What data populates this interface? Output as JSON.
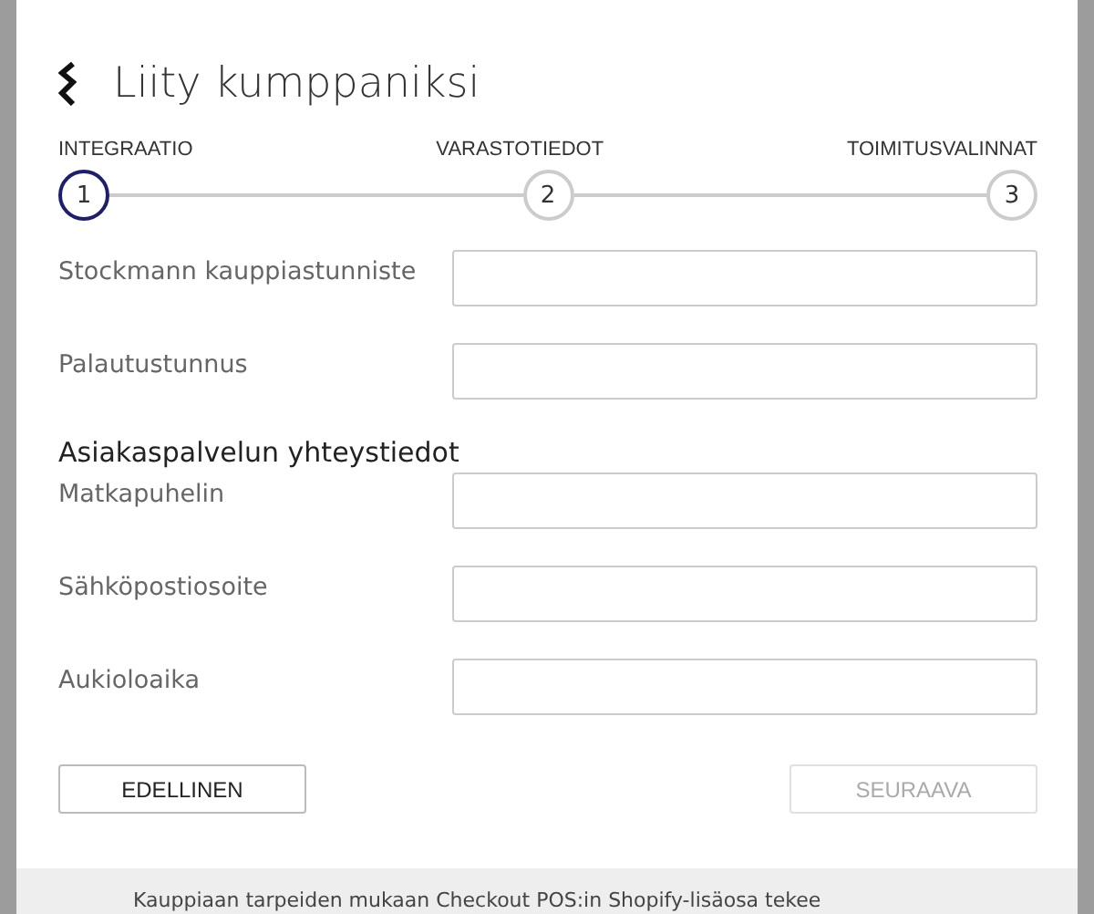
{
  "dialog": {
    "title": "Liity kumppaniksi"
  },
  "steps": [
    {
      "label": "INTEGRAATIO",
      "number": "1",
      "selected": true
    },
    {
      "label": "VARASTOTIEDOT",
      "number": "2",
      "selected": false
    },
    {
      "label": "TOIMITUSVALINNAT",
      "number": "3",
      "selected": false
    }
  ],
  "fields": [
    {
      "label": "Stockmann kauppiastunniste"
    },
    {
      "label": "Palautustunnus"
    }
  ],
  "section": {
    "heading": "Asiakaspalvelun yhteystiedot",
    "fields": [
      {
        "label": "Matkapuhelin"
      },
      {
        "label": "Sähköpostiosoite"
      },
      {
        "label": "Aukioloaika"
      }
    ]
  },
  "buttons": [
    {
      "label": "EDELLINEN",
      "disabled": false
    },
    {
      "label": "SEURAAVA",
      "disabled": true
    }
  ],
  "background_text": "Kauppiaan tarpeiden mukaan Checkout POS:in Shopify-lisäosa tekee"
}
